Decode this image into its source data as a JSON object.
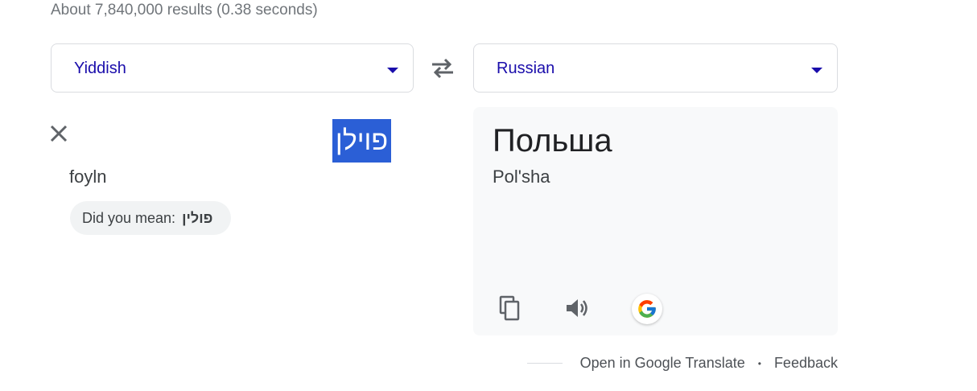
{
  "search_stats": "About 7,840,000 results (0.38 seconds)",
  "source_language": {
    "label": "Yiddish"
  },
  "target_language": {
    "label": "Russian"
  },
  "source": {
    "text": "פוילן",
    "transliteration": "foyln",
    "did_you_mean_prefix": "Did you mean:",
    "did_you_mean_word": "פולין"
  },
  "translation": {
    "text": "Польша",
    "transliteration": "Pol'sha"
  },
  "icons": {
    "clear": "close-icon",
    "swap": "swap-icon",
    "copy": "copy-icon",
    "speak": "speaker-icon",
    "google": "google-icon"
  },
  "footer": {
    "open_link": "Open in Google Translate",
    "separator": "•",
    "feedback": "Feedback"
  },
  "colors": {
    "language_label": "#1a0dab",
    "selection": "#2b5fd6",
    "panel_bg": "#f8f9fa"
  }
}
